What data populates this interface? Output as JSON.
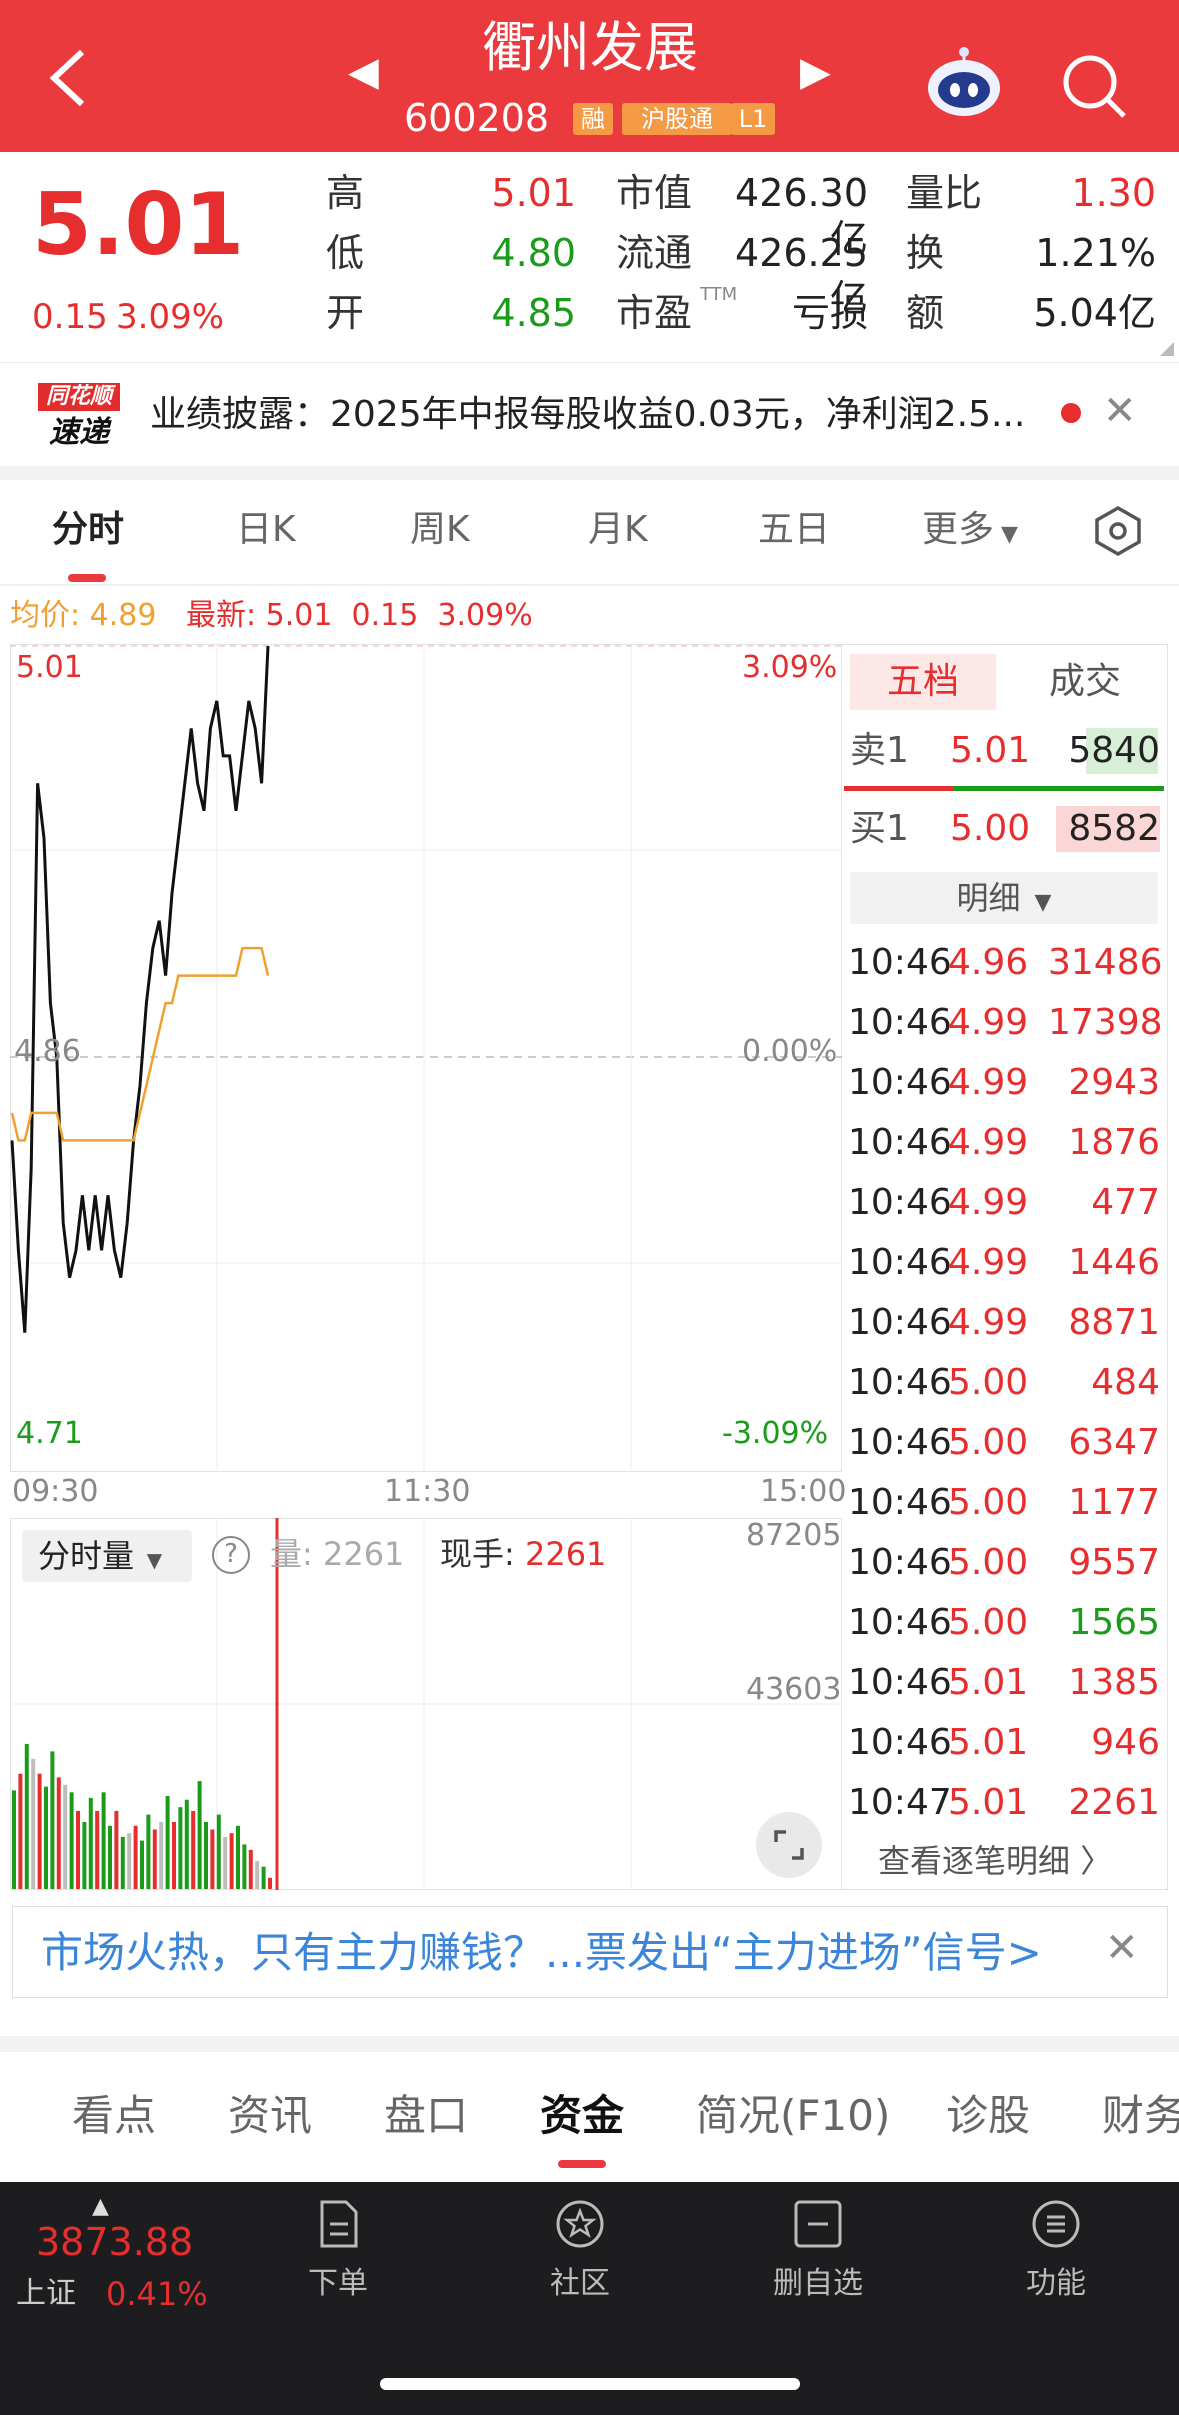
{
  "header": {
    "stock_name": "衢州发展",
    "stock_code": "600208",
    "tags": [
      "融",
      "沪股通",
      "L1"
    ]
  },
  "quote": {
    "price": "5.01",
    "change": "0.15",
    "change_pct": "3.09%",
    "rows": [
      {
        "l1": "高",
        "v1": "5.01",
        "c1": "#e62e2e",
        "l2": "市值",
        "v2": "426.30亿",
        "l3": "量比",
        "v3": "1.30",
        "c3": "#e62e2e"
      },
      {
        "l1": "低",
        "v1": "4.80",
        "c1": "#1a9c1a",
        "l2": "流通",
        "v2": "426.25亿",
        "l3": "换",
        "v3": "1.21%",
        "c3": "#222"
      },
      {
        "l1": "开",
        "v1": "4.85",
        "c1": "#1a9c1a",
        "l2": "市盈",
        "v2": "亏损",
        "l3": "额",
        "v3": "5.04亿",
        "c3": "#222"
      }
    ],
    "pe_superscript": "TTM"
  },
  "news": {
    "badge_top": "同花顺",
    "badge_bottom": "速递",
    "text": "业绩披露：2025年中报每股收益0.03元，净利润2.5..."
  },
  "chart_tabs": [
    "分时",
    "日K",
    "周K",
    "月K",
    "五日",
    "更多"
  ],
  "chart_legend": {
    "avg_label": "均价:",
    "avg_value": "4.89",
    "last_label": "最新:",
    "last_value": "5.01",
    "last_change": "0.15",
    "last_pct": "3.09%"
  },
  "price_axis": {
    "top": "5.01",
    "mid": "4.86",
    "bottom": "4.71",
    "top_pct": "3.09%",
    "mid_pct": "0.00%",
    "bottom_pct": "-3.09%"
  },
  "time_axis": [
    "09:30",
    "11:30",
    "15:00"
  ],
  "volume_panel": {
    "dropdown_label": "分时量",
    "volume_label": "量:",
    "volume_value": "2261",
    "hand_label": "现手:",
    "hand_value": "2261",
    "axis_top": "87205",
    "axis_mid": "43603"
  },
  "chart_data": {
    "type": "line",
    "x_range": [
      "09:30",
      "15:00"
    ],
    "ylim": [
      4.71,
      5.01
    ],
    "reference": 4.86,
    "series": [
      {
        "values": [
          4.83,
          4.79,
          4.76,
          4.82,
          4.96,
          4.94,
          4.88,
          4.86,
          4.8,
          4.78,
          4.79,
          4.81,
          4.79,
          4.81,
          4.79,
          4.81,
          4.79,
          4.78,
          4.8,
          4.83,
          4.85,
          4.88,
          4.9,
          4.91,
          4.89,
          4.92,
          4.94,
          4.96,
          4.98,
          4.96,
          4.95,
          4.98,
          4.99,
          4.97,
          4.97,
          4.95,
          4.97,
          4.99,
          4.98,
          4.96,
          5.01
        ]
      },
      {
        "values": [
          4.84,
          4.83,
          4.83,
          4.84,
          4.84,
          4.84,
          4.84,
          4.84,
          4.83,
          4.83,
          4.83,
          4.83,
          4.83,
          4.83,
          4.83,
          4.83,
          4.83,
          4.83,
          4.83,
          4.83,
          4.84,
          4.85,
          4.86,
          4.87,
          4.88,
          4.88,
          4.89,
          4.89,
          4.89,
          4.89,
          4.89,
          4.89,
          4.89,
          4.89,
          4.89,
          4.89,
          4.9,
          4.9,
          4.9,
          4.9,
          4.89
        ]
      }
    ]
  },
  "volume_bars": [
    0.53,
    0.62,
    0.78,
    0.7,
    0.62,
    0.55,
    0.74,
    0.6,
    0.56,
    0.52,
    0.42,
    0.36,
    0.49,
    0.42,
    0.52,
    0.34,
    0.42,
    0.28,
    0.3,
    0.34,
    0.26,
    0.4,
    0.32,
    0.36,
    0.5,
    0.36,
    0.44,
    0.48,
    0.42,
    0.58,
    0.36,
    0.32,
    0.4,
    0.28,
    0.3,
    0.34,
    0.24,
    0.21,
    0.15,
    0.12,
    0.06
  ],
  "order_book": {
    "tab_active": "五档",
    "tab_other": "成交",
    "sell_label": "卖1",
    "sell_price": "5.01",
    "sell_volume": "5840",
    "buy_label": "买1",
    "buy_price": "5.00",
    "buy_volume": "8582",
    "detail_label": "明细",
    "trades": [
      {
        "t": "10:46",
        "p": "4.96",
        "v": "31486",
        "c": "#e62e2e"
      },
      {
        "t": "10:46",
        "p": "4.99",
        "v": "17398",
        "c": "#e62e2e"
      },
      {
        "t": "10:46",
        "p": "4.99",
        "v": "2943",
        "c": "#e62e2e"
      },
      {
        "t": "10:46",
        "p": "4.99",
        "v": "1876",
        "c": "#e62e2e"
      },
      {
        "t": "10:46",
        "p": "4.99",
        "v": "477",
        "c": "#e62e2e"
      },
      {
        "t": "10:46",
        "p": "4.99",
        "v": "1446",
        "c": "#e62e2e"
      },
      {
        "t": "10:46",
        "p": "4.99",
        "v": "8871",
        "c": "#e62e2e"
      },
      {
        "t": "10:46",
        "p": "5.00",
        "v": "484",
        "c": "#e62e2e"
      },
      {
        "t": "10:46",
        "p": "5.00",
        "v": "6347",
        "c": "#e62e2e"
      },
      {
        "t": "10:46",
        "p": "5.00",
        "v": "1177",
        "c": "#e62e2e"
      },
      {
        "t": "10:46",
        "p": "5.00",
        "v": "9557",
        "c": "#e62e2e"
      },
      {
        "t": "10:46",
        "p": "5.00",
        "v": "1565",
        "c": "#1a9c1a"
      },
      {
        "t": "10:46",
        "p": "5.01",
        "v": "1385",
        "c": "#e62e2e"
      },
      {
        "t": "10:46",
        "p": "5.01",
        "v": "946",
        "c": "#e62e2e"
      },
      {
        "t": "10:47",
        "p": "5.01",
        "v": "2261",
        "c": "#e62e2e"
      }
    ],
    "more_label": "查看逐笔明细"
  },
  "banner": {
    "text": "市场火热，只有主力赚钱？...票发出“主力进场”信号>"
  },
  "bottom_tabs": [
    "看点",
    "资讯",
    "盘口",
    "资金",
    "简况(F10)",
    "诊股",
    "财务"
  ],
  "dock": {
    "index_value": "3873.88",
    "index_name": "上证",
    "index_pct": "0.41%",
    "items": [
      "下单",
      "社区",
      "删自选",
      "功能"
    ]
  },
  "colors": {
    "brand": "#ea3a3e",
    "up": "#e62e2e",
    "down": "#1a9c1a",
    "avg": "#f0a030",
    "link": "#3b86d8"
  }
}
